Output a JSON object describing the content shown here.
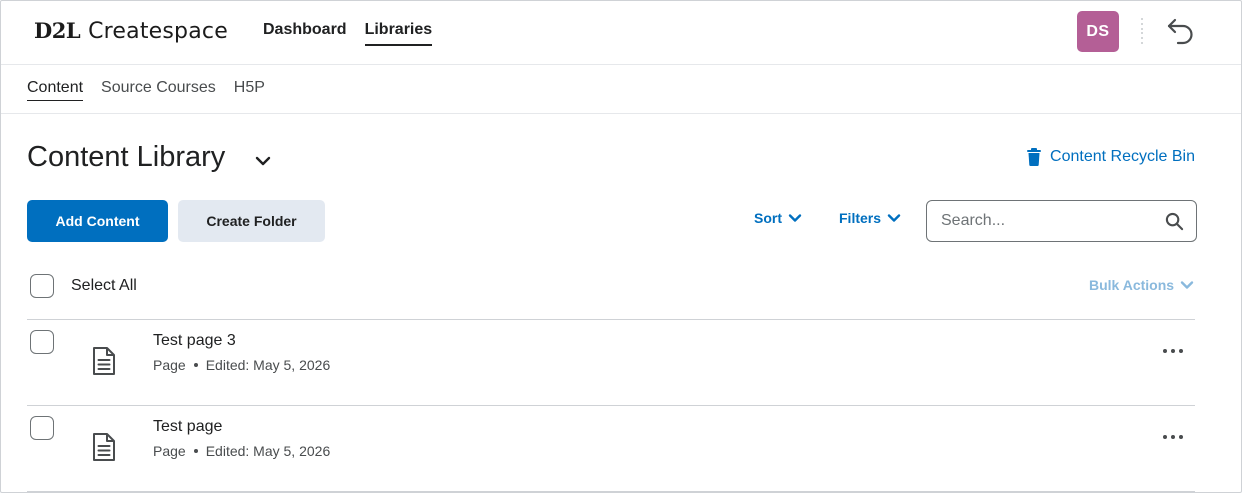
{
  "header": {
    "logo_brand": "D2L",
    "logo_product": "Createspace",
    "nav": [
      {
        "label": "Dashboard",
        "active": false
      },
      {
        "label": "Libraries",
        "active": true
      }
    ],
    "avatar_initials": "DS",
    "avatar_color": "#b45f96",
    "back_icon": "undo-arrow-icon"
  },
  "subnav": {
    "items": [
      {
        "label": "Content",
        "active": true
      },
      {
        "label": "Source Courses",
        "active": false
      },
      {
        "label": "H5P",
        "active": false
      }
    ]
  },
  "main": {
    "title": "Content Library",
    "recycle_bin_label": "Content Recycle Bin",
    "add_content_label": "Add Content",
    "create_folder_label": "Create Folder",
    "sort_label": "Sort",
    "filters_label": "Filters",
    "search_placeholder": "Search...",
    "select_all_label": "Select All",
    "bulk_actions_label": "Bulk Actions",
    "accent_color": "#006fbf"
  },
  "items": [
    {
      "title": "Test page 3",
      "type": "Page",
      "edited": "Edited: May 5, 2026"
    },
    {
      "title": "Test page",
      "type": "Page",
      "edited": "Edited: May 5, 2026"
    }
  ]
}
